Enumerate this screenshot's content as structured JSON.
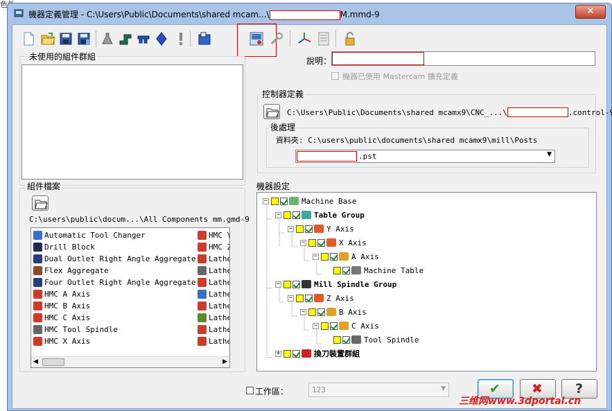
{
  "partial_left_text": "色外",
  "window": {
    "title": "機器定義管理 - C:\\Users\\Public\\Documents\\shared  mcam...\\",
    "title_suffix": "M.mmd-9",
    "close_label": "✕"
  },
  "toolbar": {
    "icons": [
      "new-file-icon",
      "open-folder-icon",
      "save-icon",
      "save-as-icon",
      "flask-icon",
      "machine-component-1-icon",
      "machine-component-2-icon",
      "machine-component-3-icon",
      "warning-icon",
      "save-blue-icon",
      "control-definition-icon",
      "wrench-icon",
      "axes-icon",
      "list-icon",
      "lock-icon"
    ]
  },
  "unused_groups": {
    "label": "未使用的組件群組"
  },
  "description": {
    "label": "說明："
  },
  "mastercam_ext": {
    "label": "機器已使用 Mastercam 擴充定義"
  },
  "controller": {
    "label": "控制器定義",
    "path": "C:\\Users\\Public\\Documents\\shared mcamx9\\CNC_...\\",
    "path_suffix": ".control-9"
  },
  "post": {
    "label": "後處理",
    "folder": "資料夾: C:\\users\\public\\documents\\shared mcamx9\\mill\\Posts",
    "select_suffix": ".pst"
  },
  "component_files": {
    "label": "組件檔案",
    "path": "C:\\users\\public\\docum...\\All Components mm.gmd-9",
    "left_items": [
      "Automatic Tool Changer",
      "Drill Block",
      "Dual Outlet Right Angle Aggregate",
      "Flex Aggregate",
      "Four Outlet Right Angle Aggregate",
      "HMC A Axis",
      "HMC B Axis",
      "HMC C Axis",
      "HMC Tool Spindle",
      "HMC X Axis"
    ],
    "right_items": [
      "HMC Y",
      "HMC Z",
      "Lathe",
      "Lathe",
      "Lathe",
      "Lathe",
      "Lathe",
      "Lathe",
      "Lathe",
      "Lathe"
    ]
  },
  "machine_setup": {
    "label": "機器設定",
    "tree": [
      {
        "label": "Machine Base",
        "bold": false
      },
      {
        "label": "Table Group",
        "bold": true
      },
      {
        "label": "Y Axis",
        "bold": false
      },
      {
        "label": "X Axis",
        "bold": false
      },
      {
        "label": "A Axis",
        "bold": false
      },
      {
        "label": "Machine Table",
        "bold": false
      },
      {
        "label": "Mill Spindle Group",
        "bold": true
      },
      {
        "label": "Z Axis",
        "bold": false
      },
      {
        "label": "B Axis",
        "bold": false
      },
      {
        "label": "C Axis",
        "bold": false
      },
      {
        "label": "Tool Spindle",
        "bold": false
      },
      {
        "label": "換刀裝置群組",
        "bold": true
      }
    ]
  },
  "workspace": {
    "label": "工作區：",
    "value": "123"
  },
  "buttons": {
    "ok": "✔",
    "cancel": "✖",
    "help": "?"
  },
  "watermark": "三维网www.3dportal.cn",
  "colors": {
    "accent_red": "#e00000",
    "tree_yellow": "#ffff00",
    "check_green": "#1a8a1a",
    "watermark_red": "#e02020"
  }
}
